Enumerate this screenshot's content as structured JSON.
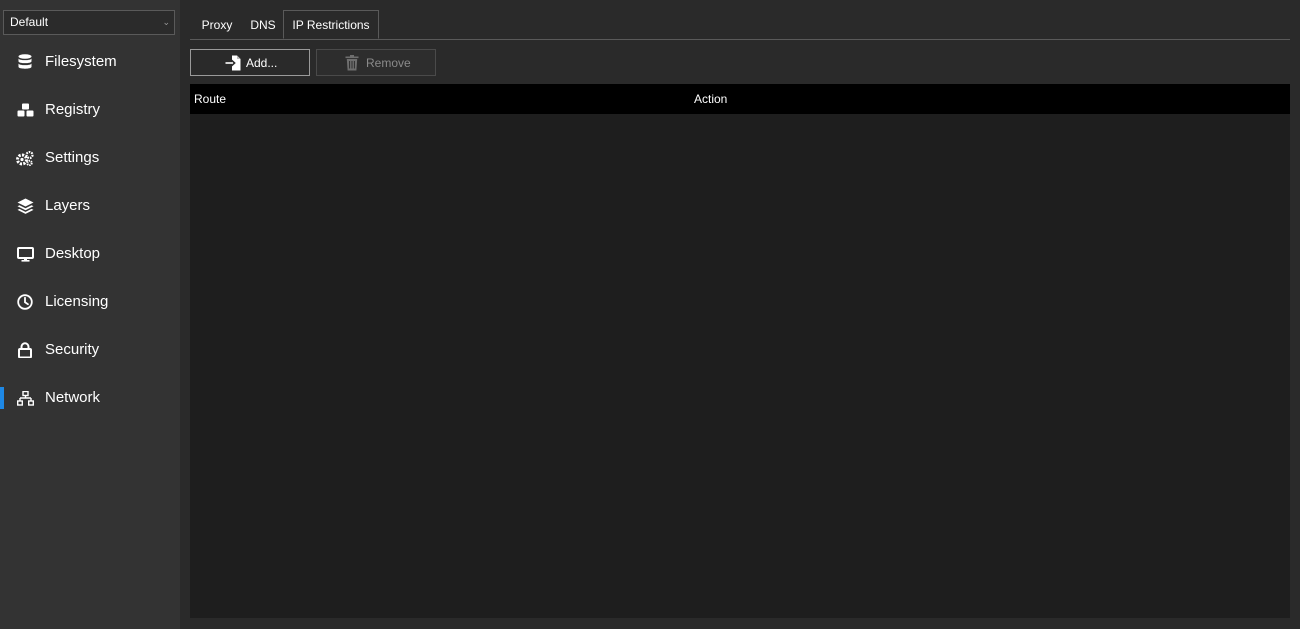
{
  "profile_select": {
    "value": "Default"
  },
  "sidebar": {
    "items": [
      {
        "label": "Filesystem",
        "icon": "database-icon",
        "active": false
      },
      {
        "label": "Registry",
        "icon": "cubes-icon",
        "active": false
      },
      {
        "label": "Settings",
        "icon": "gears-icon",
        "active": false
      },
      {
        "label": "Layers",
        "icon": "layers-icon",
        "active": false
      },
      {
        "label": "Desktop",
        "icon": "monitor-icon",
        "active": false
      },
      {
        "label": "Licensing",
        "icon": "clock-icon",
        "active": false
      },
      {
        "label": "Security",
        "icon": "lock-icon",
        "active": false
      },
      {
        "label": "Network",
        "icon": "network-icon",
        "active": true
      }
    ]
  },
  "tabs": [
    {
      "label": "Proxy",
      "active": false
    },
    {
      "label": "DNS",
      "active": false
    },
    {
      "label": "IP Restrictions",
      "active": true
    }
  ],
  "toolbar": {
    "add_label": "Add...",
    "add_icon": "file-import-icon",
    "remove_label": "Remove",
    "remove_icon": "trash-icon",
    "remove_enabled": false
  },
  "table": {
    "columns": [
      "Route",
      "Action"
    ],
    "rows": []
  },
  "colors": {
    "accent": "#1e88e5",
    "sidebar_bg": "#333333",
    "main_bg": "#2a2a2a",
    "table_bg": "#1e1e1e",
    "table_header_bg": "#000000"
  }
}
